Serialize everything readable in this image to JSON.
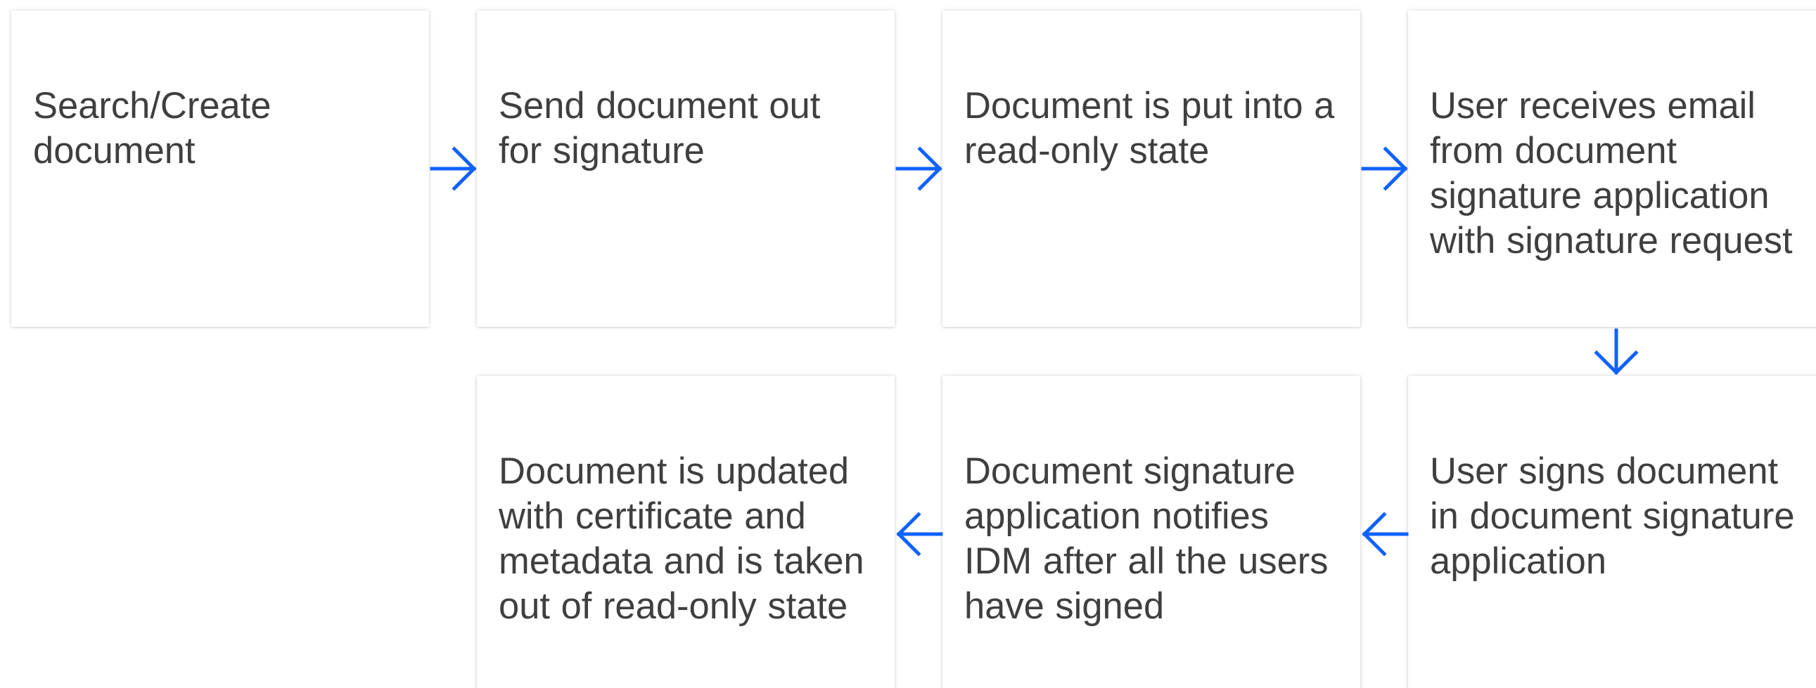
{
  "diagram": {
    "steps": [
      {
        "id": "search-create",
        "text": "Search/Create\ndocument"
      },
      {
        "id": "send-for-signature",
        "text": "Send document out\nfor signature"
      },
      {
        "id": "read-only",
        "text": "Document is put into a\nread-only state"
      },
      {
        "id": "receive-email",
        "text": "User receives email\nfrom  document\nsignature application\nwith signature request"
      },
      {
        "id": "user-signs",
        "text": "User signs document\nin document signature\napplication"
      },
      {
        "id": "app-notifies",
        "text": "Document signature\napplication notifies\nIDM after all the users\nhave signed"
      },
      {
        "id": "document-updated",
        "text": "Document is updated\nwith certificate and\nmetadata and is taken\nout of read-only state"
      }
    ],
    "connectors": [
      {
        "from": "search-create",
        "to": "send-for-signature",
        "direction": "right"
      },
      {
        "from": "send-for-signature",
        "to": "read-only",
        "direction": "right"
      },
      {
        "from": "read-only",
        "to": "receive-email",
        "direction": "right"
      },
      {
        "from": "receive-email",
        "to": "user-signs",
        "direction": "down"
      },
      {
        "from": "user-signs",
        "to": "app-notifies",
        "direction": "left"
      },
      {
        "from": "app-notifies",
        "to": "document-updated",
        "direction": "left"
      }
    ],
    "arrow_color": "#0f62fe",
    "text_color": "#3f3f3f",
    "box_color": "#ffffff"
  }
}
